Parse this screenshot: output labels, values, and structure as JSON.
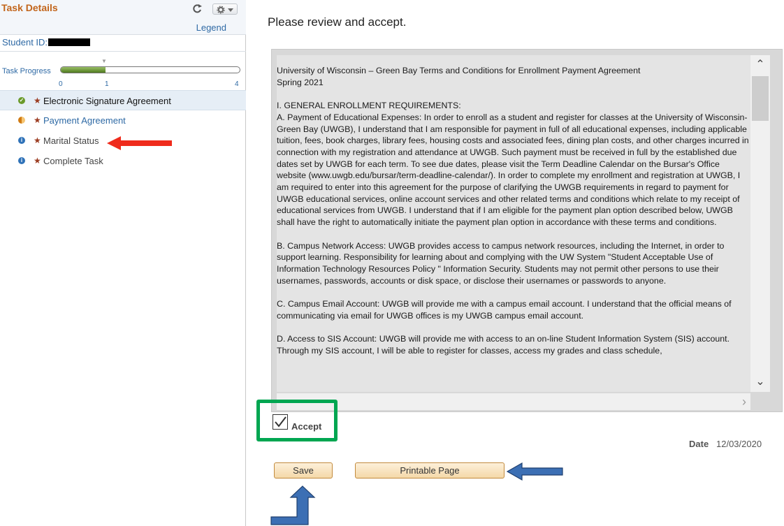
{
  "left_panel": {
    "title": "Task Details",
    "legend_link": "Legend",
    "student_id_label": "Student ID:",
    "progress": {
      "label": "Task Progress",
      "ticks": [
        "0",
        "1",
        "4"
      ],
      "completed": 1,
      "total": 4
    },
    "tasks": [
      {
        "label": "Electronic Signature Agreement",
        "status": "complete-icon",
        "selected": true
      },
      {
        "label": "Payment Agreement",
        "status": "in-progress-icon",
        "selected": false
      },
      {
        "label": "Marital Status",
        "status": "info-icon",
        "selected": false
      },
      {
        "label": "Complete Task",
        "status": "info-icon",
        "selected": false
      }
    ],
    "required_marker": "★"
  },
  "main": {
    "heading": "Please review and accept.",
    "terms": {
      "title_line1": "University of Wisconsin – Green Bay Terms and Conditions for Enrollment Payment Agreement",
      "title_line2": "Spring 2021",
      "section_heading": "I.   GENERAL ENROLLMENT REQUIREMENTS:",
      "para_a": "A.   Payment of Educational Expenses:  In order to enroll as a student and register for classes at the University of Wisconsin-Green Bay (UWGB), I understand that I am responsible for payment in full of all educational expenses, including applicable tuition, fees, book charges, library fees, housing costs and associated fees, dining plan costs, and other charges incurred in connection with my registration and attendance at UWGB. Such payment must be received in full by the established due dates set by UWGB for each term. To see due dates, please visit the Term Deadline Calendar on the Bursar's Office website (www.uwgb.edu/bursar/term-deadline-calendar/). In order to complete my enrollment and registration at UWGB, I am required to enter into this agreement for the purpose of clarifying the UWGB requirements in regard to payment for UWGB educational services, online account services and other related terms and conditions which relate to my receipt of educational services from UWGB. I understand that if I am eligible for the payment plan option described below, UWGB shall have the right to automatically initiate the payment plan option in accordance with these terms and conditions.",
      "para_b": "B.   Campus Network Access: UWGB provides access to campus network resources, including the Internet, in order to support learning. Responsibility for learning about and complying with the UW System \"Student Acceptable Use of Information Technology Resources Policy \" Information Security. Students may not permit other persons to use their usernames, passwords, accounts or disk space, or disclose their usernames or passwords to anyone.",
      "para_c": "C.   Campus Email Account: UWGB will provide me with a campus email account. I understand that the official means of communicating via email for UWGB offices is my UWGB campus email account.",
      "para_d": "D.   Access to SIS Account: UWGB will provide me with access to an on-line Student Information System (SIS) account. Through my SIS account, I will be able to register for classes, access my grades and class schedule,"
    },
    "accept": {
      "label": "Accept",
      "checked": true
    },
    "date_label": "Date",
    "date_value": "12/03/2020",
    "buttons": {
      "save": "Save",
      "printable": "Printable Page"
    }
  },
  "annotations": {
    "red_arrow_color": "#ef2b1c",
    "green_highlight_color": "#00a651",
    "blue_arrow_color": "#3c6fb4"
  }
}
